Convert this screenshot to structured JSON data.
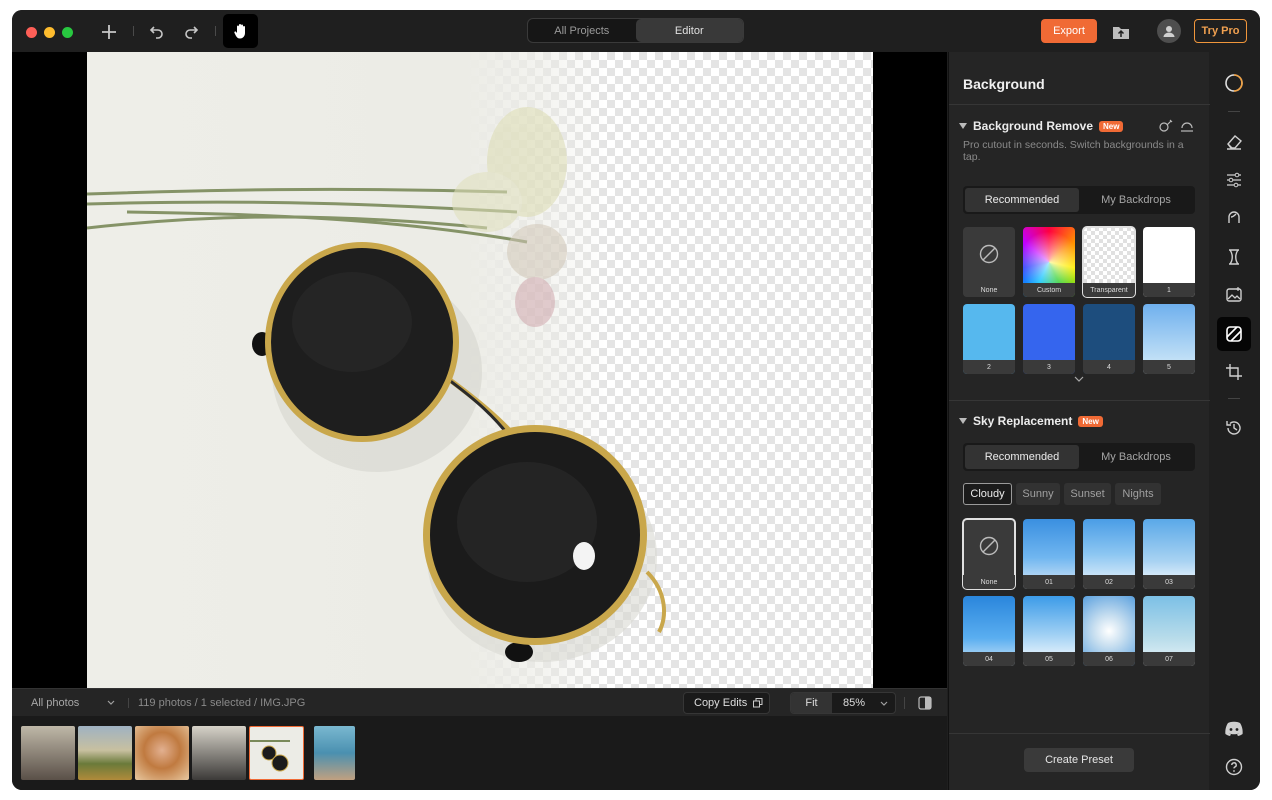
{
  "titlebar": {
    "tabs": [
      {
        "label": "All Projects",
        "active": false
      },
      {
        "label": "Editor",
        "active": true
      }
    ],
    "export_label": "Export",
    "try_pro_label": "Try Pro",
    "icons": [
      "plus-icon",
      "undo-icon",
      "redo-icon",
      "hand-icon",
      "import-folder-icon",
      "user-icon"
    ]
  },
  "bottombar": {
    "album": "All photos",
    "info": "119 photos / 1 selected / IMG.JPG",
    "copy_edits": "Copy Edits",
    "fit": "Fit",
    "zoom": "85%"
  },
  "panel": {
    "title": "Background",
    "bg_remove": {
      "title": "Background Remove",
      "badge": "New",
      "description": "Pro cutout in seconds. Switch backgrounds in a tap.",
      "tabs": [
        "Recommended",
        "My Backdrops"
      ],
      "swatches": [
        {
          "label": "None",
          "color": "#3a3a3a"
        },
        {
          "label": "Custom",
          "color": "rainbow"
        },
        {
          "label": "Transparent",
          "color": "checker",
          "selected": true
        },
        {
          "label": "1",
          "color": "#ffffff"
        },
        {
          "label": "2",
          "color": "#56b8ee"
        },
        {
          "label": "3",
          "color": "#3565ee"
        },
        {
          "label": "4",
          "color": "#1d4d7d"
        },
        {
          "label": "5",
          "color": "gradient-sky"
        }
      ]
    },
    "sky": {
      "title": "Sky Replacement",
      "badge": "New",
      "tabs": [
        "Recommended",
        "My Backdrops"
      ],
      "chips": [
        {
          "label": "Cloudy",
          "active": true
        },
        {
          "label": "Sunny",
          "active": false
        },
        {
          "label": "Sunset",
          "active": false
        },
        {
          "label": "Nights",
          "active": false
        }
      ],
      "items": [
        "None",
        "01",
        "02",
        "03",
        "04",
        "05",
        "06",
        "07"
      ]
    },
    "create_preset": "Create Preset"
  },
  "rail": {
    "tools": [
      "ai-enhance-icon",
      "eraser-icon",
      "adjust-sliders-icon",
      "face-retouch-icon",
      "body-shape-icon",
      "image-generate-icon",
      "background-icon",
      "crop-icon",
      "history-icon"
    ],
    "active": "background-icon",
    "bottom": [
      "discord-icon",
      "help-icon"
    ]
  }
}
